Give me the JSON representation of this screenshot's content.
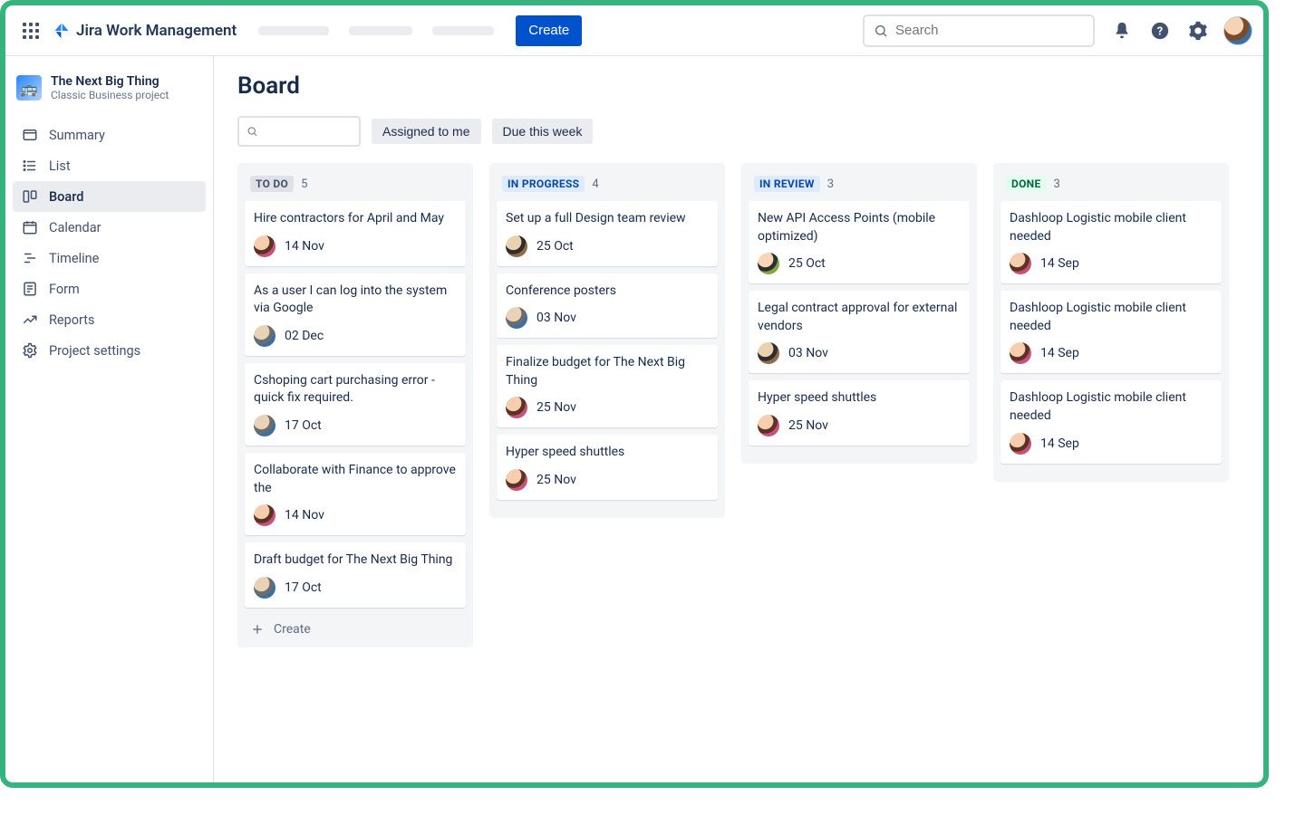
{
  "header": {
    "product_name": "Jira Work Management",
    "create_button": "Create",
    "search_placeholder": "Search"
  },
  "sidebar": {
    "project_name": "The Next Big Thing",
    "project_type": "Classic Business project",
    "items": [
      {
        "label": "Summary"
      },
      {
        "label": "List"
      },
      {
        "label": "Board"
      },
      {
        "label": "Calendar"
      },
      {
        "label": "Timeline"
      },
      {
        "label": "Form"
      },
      {
        "label": "Reports"
      },
      {
        "label": "Project settings"
      }
    ]
  },
  "page": {
    "title": "Board",
    "filters": {
      "assigned": "Assigned to me",
      "due": "Due this week"
    },
    "create_label": "Create"
  },
  "columns": [
    {
      "key": "todo",
      "title": "TO DO",
      "count": "5",
      "cards": [
        {
          "title": "Hire contractors for April and May",
          "date": "14 Nov",
          "avatar": "a"
        },
        {
          "title": "As a user I can log into the system via Google",
          "date": "02 Dec",
          "avatar": "b"
        },
        {
          "title": "Cshoping cart purchasing error - quick fix required.",
          "date": "17 Oct",
          "avatar": "b"
        },
        {
          "title": "Collaborate with Finance to approve the",
          "date": "14 Nov",
          "avatar": "a"
        },
        {
          "title": "Draft budget for The Next Big Thing",
          "date": "17 Oct",
          "avatar": "b"
        }
      ]
    },
    {
      "key": "inprogress",
      "title": "IN PROGRESS",
      "count": "4",
      "cards": [
        {
          "title": "Set up a full Design team review",
          "date": "25 Oct",
          "avatar": "c"
        },
        {
          "title": "Conference posters",
          "date": "03 Nov",
          "avatar": "b"
        },
        {
          "title": "Finalize budget for The Next Big Thing",
          "date": "25 Nov",
          "avatar": "a"
        },
        {
          "title": "Hyper speed shuttles",
          "date": "25 Nov",
          "avatar": "a"
        }
      ]
    },
    {
      "key": "inreview",
      "title": "IN REVIEW",
      "count": "3",
      "cards": [
        {
          "title": "New API Access Points (mobile optimized)",
          "date": "25 Oct",
          "avatar": "d"
        },
        {
          "title": "Legal contract approval for external vendors",
          "date": "03 Nov",
          "avatar": "c"
        },
        {
          "title": "Hyper speed shuttles",
          "date": "25 Nov",
          "avatar": "a"
        }
      ]
    },
    {
      "key": "done",
      "title": "DONE",
      "count": "3",
      "cards": [
        {
          "title": "Dashloop Logistic mobile client needed",
          "date": "14 Sep",
          "avatar": "a"
        },
        {
          "title": "Dashloop Logistic mobile client needed",
          "date": "14 Sep",
          "avatar": "a"
        },
        {
          "title": "Dashloop Logistic mobile client needed",
          "date": "14 Sep",
          "avatar": "a"
        }
      ]
    }
  ]
}
